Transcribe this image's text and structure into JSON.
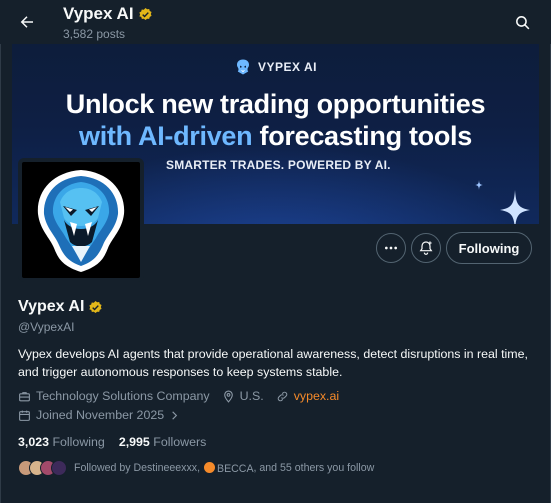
{
  "header": {
    "title": "Vypex AI",
    "posts_count": "3,582 posts",
    "back_icon": "arrow-left-icon",
    "search_icon": "search-icon"
  },
  "banner": {
    "brand": "VYPEX AI",
    "headline_line1": "Unlock new trading opportunities",
    "headline_accent": "with AI-driven",
    "headline_rest": " forecasting tools",
    "subtitle": "SMARTER TRADES. POWERED BY AI."
  },
  "actions": {
    "more_icon": "more-icon",
    "notify_icon": "bell-plus-icon",
    "following_label": "Following"
  },
  "profile": {
    "name": "Vypex AI",
    "handle": "@VypexAI",
    "bio": "Vypex develops AI agents that provide operational awareness, detect disruptions in real time, and trigger autonomous responses to keep systems stable.",
    "category": "Technology Solutions Company",
    "location": "U.S.",
    "website": "vypex.ai",
    "joined": "Joined November 2025"
  },
  "stats": {
    "following_count": "3,023",
    "following_label": "Following",
    "followers_count": "2,995",
    "followers_label": "Followers"
  },
  "followed_by": {
    "prefix": "Followed by Destineeexxx,",
    "name2": "BECCA",
    "suffix": ", and 55 others you follow"
  },
  "colors": {
    "background": "#15202b",
    "accent_link": "#f58a2a",
    "verified_badge": "#e2b719",
    "muted_text": "#8b98a5"
  }
}
